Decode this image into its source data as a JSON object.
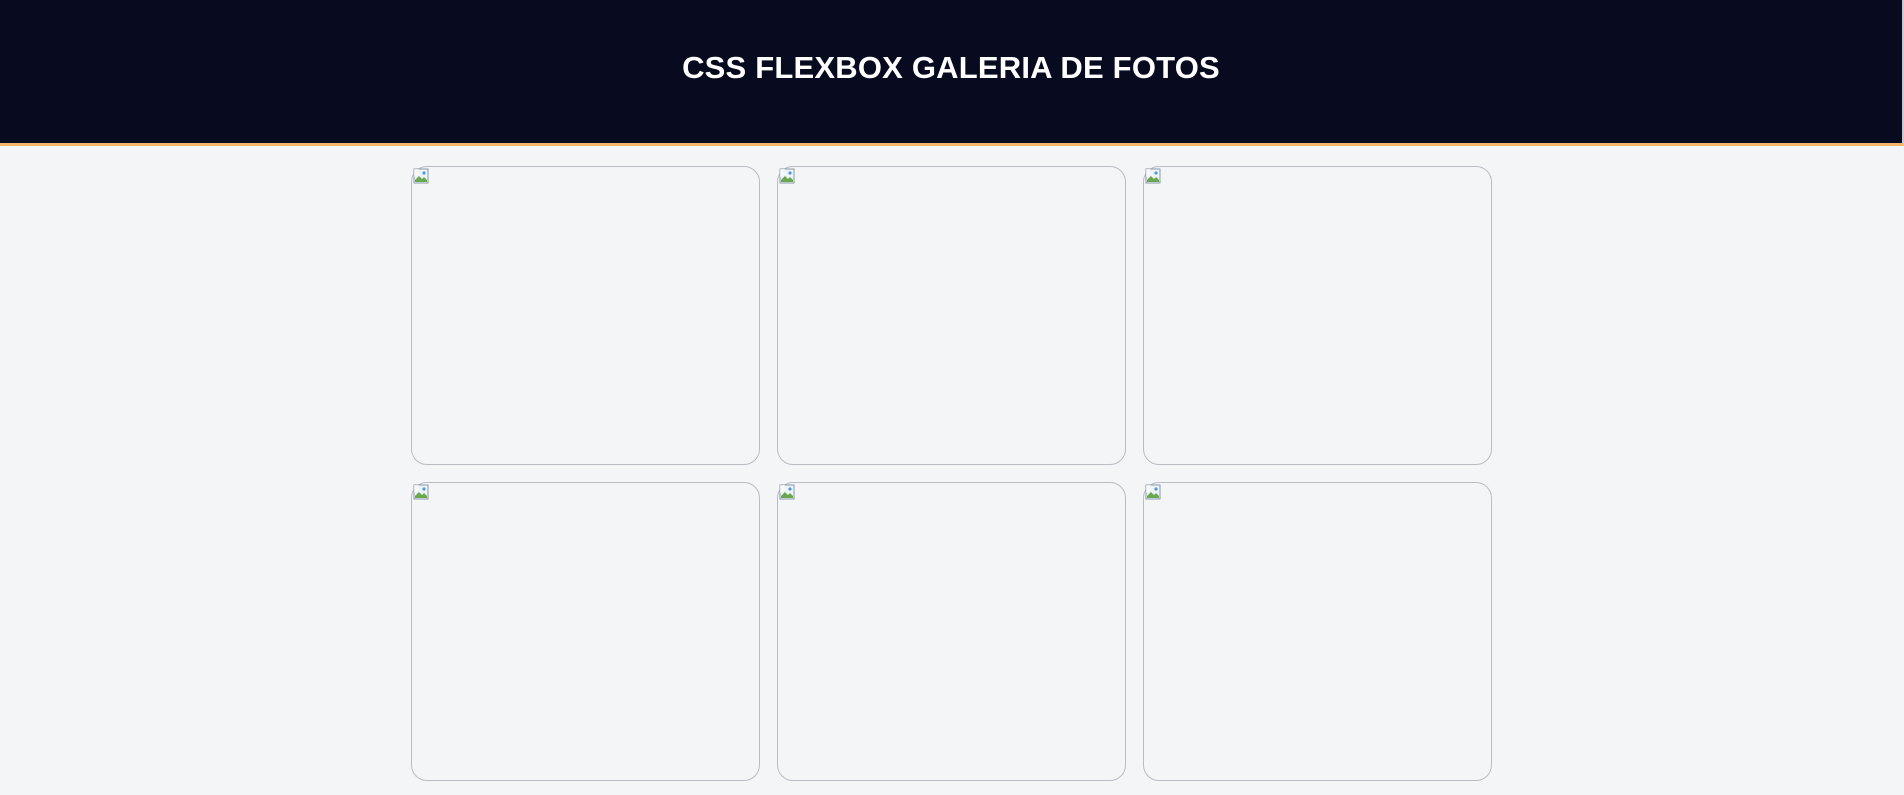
{
  "header": {
    "title": "CSS FLEXBOX GALERIA DE FOTOS"
  },
  "gallery": {
    "photos": [
      {
        "alt": "",
        "icon": "broken-image-icon"
      },
      {
        "alt": "",
        "icon": "broken-image-icon"
      },
      {
        "alt": "",
        "icon": "broken-image-icon"
      },
      {
        "alt": "",
        "icon": "broken-image-icon"
      },
      {
        "alt": "",
        "icon": "broken-image-icon"
      },
      {
        "alt": "",
        "icon": "broken-image-icon"
      }
    ]
  },
  "colors": {
    "header_bg": "#080a20",
    "header_border": "#f4b46a",
    "page_bg": "#f4f5f7",
    "title_text": "#ffffff"
  }
}
